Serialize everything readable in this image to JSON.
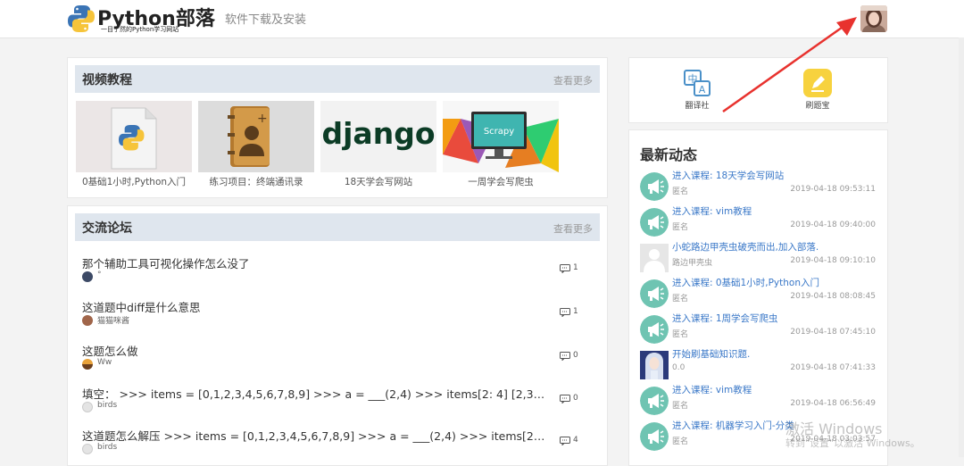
{
  "header": {
    "logo_title": "Python部落",
    "logo_subtitle": "一目了然的Python学习网站",
    "nav_link": "软件下载及安装"
  },
  "video_section": {
    "title": "视频教程",
    "more": "查看更多",
    "items": [
      {
        "caption": "0基础1小时,Python入门",
        "icon": "python-doc-icon"
      },
      {
        "caption": "练习项目：终端通讯录",
        "icon": "address-book-icon"
      },
      {
        "caption": "18天学会写网站",
        "icon": "django-logo"
      },
      {
        "caption": "一周学会写爬虫",
        "icon": "scrapy-monitor-icon"
      }
    ]
  },
  "forum_section": {
    "title": "交流论坛",
    "more": "查看更多",
    "topics": [
      {
        "title": "那个辅助工具可视化操作怎么没了",
        "user": "°",
        "comments": "1"
      },
      {
        "title": "这道题中diff是什么意思",
        "user": "猫猫咪酱",
        "comments": "1"
      },
      {
        "title": "这题怎么做",
        "user": "Ww",
        "comments": "0"
      },
      {
        "title": "填空：  >>> items = [0,1,2,3,4,5,6,7,8,9] >>> a = ___(2,4) >>> items[2: 4] [2,3] >>> items[...",
        "user": "birds",
        "comments": "0"
      },
      {
        "title": "这道题怎么解压 >>> items = [0,1,2,3,4,5,6,7,8,9] >>> a = ___(2,4) >>> items[2: 4] [2,3] >...",
        "user": "birds",
        "comments": "4"
      }
    ]
  },
  "tools": [
    {
      "label": "翻译社",
      "icon": "translate-icon"
    },
    {
      "label": "刷题宝",
      "icon": "pencil-icon"
    }
  ],
  "activity": {
    "title": "最新动态",
    "items": [
      {
        "title": "进入课程: 18天学会写网站",
        "user": "匿名",
        "time": "2019-04-18 09:53:11",
        "avatar": "megaphone"
      },
      {
        "title": "进入课程: vim教程",
        "user": "匿名",
        "time": "2019-04-18 09:40:00",
        "avatar": "megaphone"
      },
      {
        "title": "小蛇路边甲壳虫破壳而出,加入部落.",
        "user": "路边甲壳虫",
        "time": "2019-04-18 09:10:10",
        "avatar": "default-user"
      },
      {
        "title": "进入课程: 0基础1小时,Python入门",
        "user": "匿名",
        "time": "2019-04-18 08:08:45",
        "avatar": "megaphone"
      },
      {
        "title": "进入课程: 1周学会写爬虫",
        "user": "匿名",
        "time": "2019-04-18 07:45:10",
        "avatar": "megaphone"
      },
      {
        "title": "开始刷基础知识题.",
        "user": "0.0",
        "time": "2019-04-18 07:41:33",
        "avatar": "anime-girl"
      },
      {
        "title": "进入课程: vim教程",
        "user": "匿名",
        "time": "2019-04-18 06:56:49",
        "avatar": "megaphone"
      },
      {
        "title": "进入课程: 机器学习入门-分类",
        "user": "匿名",
        "time": "2019-04-18 03:03:57",
        "avatar": "megaphone"
      }
    ]
  },
  "watermark": {
    "line1": "激活 Windows",
    "line2": "转到\"设置\"以激活 Windows。"
  },
  "colors": {
    "panel_header_bg": "#dfe6ee",
    "link_blue": "#3a78c8",
    "megaphone_bg": "#6fc4b2",
    "arrow_red": "#e8322e"
  }
}
